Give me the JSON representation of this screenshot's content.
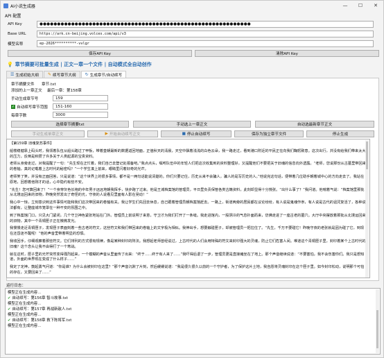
{
  "window": {
    "title": "AI小说生成器",
    "controls": [
      "—",
      "☐",
      "✕"
    ]
  },
  "api_group": {
    "label": "API 配置",
    "api_key_label": "API Key",
    "api_key_value": "●●●●●●●●●●●●●●●●●●●●●●●●●●●●●●●●●●●●●●●●●●●●●●●●●●●●●●●●●●●●",
    "base_url_label": "Base URL",
    "base_url_value": "https://ark.cn-beijing.volces.com/api/v3",
    "model_label": "模型名称",
    "model_value": "ep-2026**********-vvlgr",
    "save_button": "保存API Key",
    "clear_button": "清除API Key"
  },
  "banner": {
    "text": "章节摘要可批量生成 | 正文一章一个文件 | 自动模式全自动创作"
  },
  "tabs": [
    {
      "label": "生成初始大纲",
      "icon": "list-icon",
      "active": false
    },
    {
      "label": "续写章节大纲",
      "icon": "pencil-icon",
      "active": false
    },
    {
      "label": "生成章节/自动续写",
      "icon": "refresh-icon",
      "active": true
    }
  ],
  "chapter_form": {
    "summary_file_label": "章节摘要文件",
    "summary_file_value": "章节.txt",
    "prev_chapter_label": "添加的上一章正文",
    "prev_chapter_value": "最后一章：第158章",
    "start_chapter_label": "手动生成章节号",
    "start_chapter_value": "159",
    "auto_range_label": "自动续写章节范围",
    "auto_range_value": "151-160",
    "word_count_label": "每章字数",
    "word_count_value": "3000"
  },
  "buttons_row1": {
    "select_file": "选择章节摘要txt",
    "manual_prev": "手动选上一章正文",
    "auto_latest": "自动选最新章节正文"
  },
  "buttons_row2": {
    "manual_generate": "手动生成单章正文",
    "start_auto": "开始自动续写正文",
    "stop_auto": "停止自动续写",
    "save_file": "保存为独立章节文件",
    "stop_generate": "停止生成"
  },
  "body_text": [
    "【第159章 旧魂复苏事件】",
    "船楼稳健靠上码头时，我领着队伍从船头踏过了甲板，带着皇朝最新的数据返回地面，正值秋天的清晨，天空中飘着浅浅的白色云朵，我一路走过，看到港口附近的平民正在向我们鞠躬致意。这次出行，并没有给我们带来太大的压力，反倒是积攒了许多关于人类起源的宝贵资料。",
    "老师从身旁走过，对我提醒了一句：“先生现在正忙着，我们自己去登记处报备吧。”我点点头，嘱咐队伍中的年轻人们把这次收集到的资料整理好，又提醒他们不要把关于旧魂的信息向外透露。“老师，您说那份从古墓里带回来的卷轴，真的记载着上古时代的秘密吗？”一个学生凑上前来，眼睛里闪着好奇的光芒。",
    "老师笑了笑，并没有正面回答，只是说道：“这个世界上的很多事情，都不是一两句话能说清楚的。你们只要记住，历史从来不会骗人，骗人的是写历史的人。”他说完这句话，便带着几位助手朝着城中心的方向走去了。我站在原地，回想着他刚才的话，心中隐约有些不安。",
    "“先生！您可算回来了！”一个身穿灰色长袍的中年男子远远地朝我挥手，快步跑了过来。他是王城档案馆的管理员，平日里负责保管各类古籍资料，此刻却显得十分慌张。“出什么事了？”我问道。他喘着气说：“档案馆里那批从北境运回来的旧物，昨晚突然发出了奇怪的光，守夜的人说看见里面有人影在晃动！”",
    "我心中一惊，立刻意识到这件事情可能和我们这次带回来的卷轴有关。我让学生们先回去休息，自己跟着管理员朝档案馆赶去。一路上，街道两旁的居民都在议论纷纷，有人说是鬼魂作祟，有人说是古代的诅咒复活了，各种说法都有，让整座城市笼罩在一种不安的氛围之中。",
    "到了档案馆门口，只见大门紧闭，几个守卫神色紧张地站在门外。管理员上前说明了来意，守卫才为我们打开了一条缝。我走进馆内，一股阴冷的气息扑面而来，仿佛走进了一座古老的墓穴。大厅中央摆放着那批从北境运回来的旧物，其中一个青铜匣子正在微微发光。",
    "我慢慢走近青铜匣子，发现匣子表面刻着一些古老的符文，这些符文和我们带回来的卷轴上的文字极为相似。我伸出手，想要触碰匣子，却被管理员一把拉住了。“先生，千万不要碰它！昨晚守夜的老张就是因为碰了它，到现在还昏迷不醒呢！”他的声音里带着明显的恐惧。",
    "我收回手，仔细观察着那些符文。它们排列的方式很有规律，像是某种封印的阵法。我想起老师曾经说过，上古时代的人们会用特殊的符文来封印强大的灵魂，防止它们危害人间。难道这个青铜匣子里，封印着某个上古时代的旧魂？这个念头让我不由得打了一个寒战。",
    "就在这时，匣子里的光芒突然变得强烈起来，一个模糊的声音从里面传了出来：“终于……终于有人来了……”我吓得后退了一步，管理员更是直接瘫坐在了地上。那个声音继续说道：“不要害怕，我不会伤害你们。我只是想知道，外面的世界现在变成了什么样子……”",
    "我定了定神，鼓起勇气问道：“你是谁？为什么会被封印在这里？”那个声音沉默了片刻，然后缓缓说道：“我是很久很久以前的一个守护者，为了保护这片土地，我自愿将灵魂封印在这个匣子里。如今封印松动，说明那个可怕的存在，又要回来了……”"
  ],
  "log": {
    "label": "运行日志：",
    "lines": [
      {
        "ok": false,
        "text": "模型正在生成内容..."
      },
      {
        "ok": true,
        "text": "自动续写：第156章 智斗故事.txt"
      },
      {
        "ok": false,
        "text": "模型正在生成内容..."
      },
      {
        "ok": true,
        "text": "自动续写：第157章 再战新敌人.txt"
      },
      {
        "ok": false,
        "text": "模型正在生成内容..."
      },
      {
        "ok": true,
        "text": "自动续写：第158章 救下陈将军.txt"
      },
      {
        "ok": false,
        "text": "模型正在生成内容..."
      }
    ]
  }
}
